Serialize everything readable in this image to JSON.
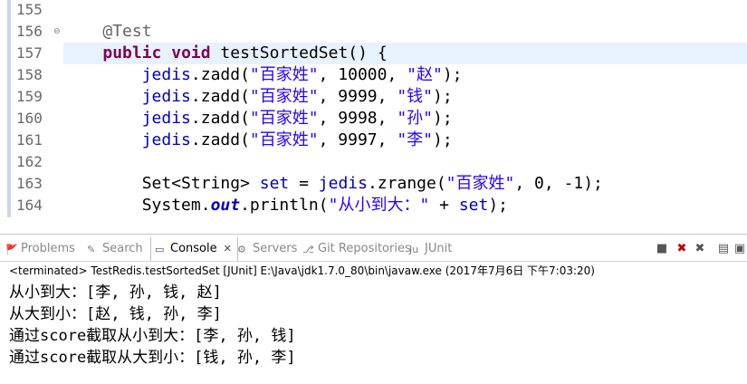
{
  "editor": {
    "lines": [
      {
        "num": "155",
        "tokens": []
      },
      {
        "num": "156",
        "fold": true,
        "tokens": [
          {
            "t": "    "
          },
          {
            "t": "@Test",
            "c": "ann"
          }
        ]
      },
      {
        "num": "157",
        "current": true,
        "tokens": [
          {
            "t": "    "
          },
          {
            "t": "public",
            "c": "kw"
          },
          {
            "t": " "
          },
          {
            "t": "void",
            "c": "kw"
          },
          {
            "t": " testSortedSet() {"
          }
        ]
      },
      {
        "num": "158",
        "tokens": [
          {
            "t": "        "
          },
          {
            "t": "jedis",
            "c": "fld"
          },
          {
            "t": ".zadd("
          },
          {
            "t": "\"百家姓\"",
            "c": "str"
          },
          {
            "t": ", 10000, "
          },
          {
            "t": "\"赵\"",
            "c": "str"
          },
          {
            "t": ");"
          }
        ]
      },
      {
        "num": "159",
        "tokens": [
          {
            "t": "        "
          },
          {
            "t": "jedis",
            "c": "fld"
          },
          {
            "t": ".zadd("
          },
          {
            "t": "\"百家姓\"",
            "c": "str"
          },
          {
            "t": ", 9999, "
          },
          {
            "t": "\"钱\"",
            "c": "str"
          },
          {
            "t": ");"
          }
        ]
      },
      {
        "num": "160",
        "tokens": [
          {
            "t": "        "
          },
          {
            "t": "jedis",
            "c": "fld"
          },
          {
            "t": ".zadd("
          },
          {
            "t": "\"百家姓\"",
            "c": "str"
          },
          {
            "t": ", 9998, "
          },
          {
            "t": "\"孙\"",
            "c": "str"
          },
          {
            "t": ");"
          }
        ]
      },
      {
        "num": "161",
        "tokens": [
          {
            "t": "        "
          },
          {
            "t": "jedis",
            "c": "fld"
          },
          {
            "t": ".zadd("
          },
          {
            "t": "\"百家姓\"",
            "c": "str"
          },
          {
            "t": ", 9997, "
          },
          {
            "t": "\"李\"",
            "c": "str"
          },
          {
            "t": ");"
          }
        ]
      },
      {
        "num": "162",
        "tokens": []
      },
      {
        "num": "163",
        "tokens": [
          {
            "t": "        Set<String> "
          },
          {
            "t": "set",
            "c": "fld"
          },
          {
            "t": " = "
          },
          {
            "t": "jedis",
            "c": "fld"
          },
          {
            "t": ".zrange("
          },
          {
            "t": "\"百家姓\"",
            "c": "str"
          },
          {
            "t": ", 0, -1);"
          }
        ]
      },
      {
        "num": "164",
        "tokens": [
          {
            "t": "        System."
          },
          {
            "t": "out",
            "c": "stat"
          },
          {
            "t": ".println("
          },
          {
            "t": "\"从小到大：\"",
            "c": "str"
          },
          {
            "t": " + "
          },
          {
            "t": "set",
            "c": "fld"
          },
          {
            "t": ");"
          }
        ]
      }
    ]
  },
  "tabs": [
    {
      "label": "Problems",
      "icon": "problems-icon"
    },
    {
      "label": "Search",
      "icon": "search-icon"
    },
    {
      "label": "Console",
      "icon": "console-icon",
      "active": true
    },
    {
      "label": "Servers",
      "icon": "servers-icon"
    },
    {
      "label": "Git Repositories",
      "icon": "git-icon"
    },
    {
      "label": "JUnit",
      "icon": "junit-icon"
    }
  ],
  "console": {
    "terminated": "<terminated> TestRedis.testSortedSet [JUnit] E:\\Java\\jdk1.7.0_80\\bin\\javaw.exe (2017年7月6日 下午7:03:20)",
    "output": [
      "从小到大：[李, 孙, 钱, 赵]",
      "从大到小：[赵, 钱, 孙, 李]",
      "通过score截取从小到大：[李, 孙, 钱]",
      "通过score截取从大到小：[钱, 孙, 李]"
    ]
  },
  "colors": {
    "keyword": "#7f0055",
    "annotation": "#646464",
    "field": "#0000c0",
    "string": "#2a00ff",
    "current_line": "#e8f2fe"
  }
}
